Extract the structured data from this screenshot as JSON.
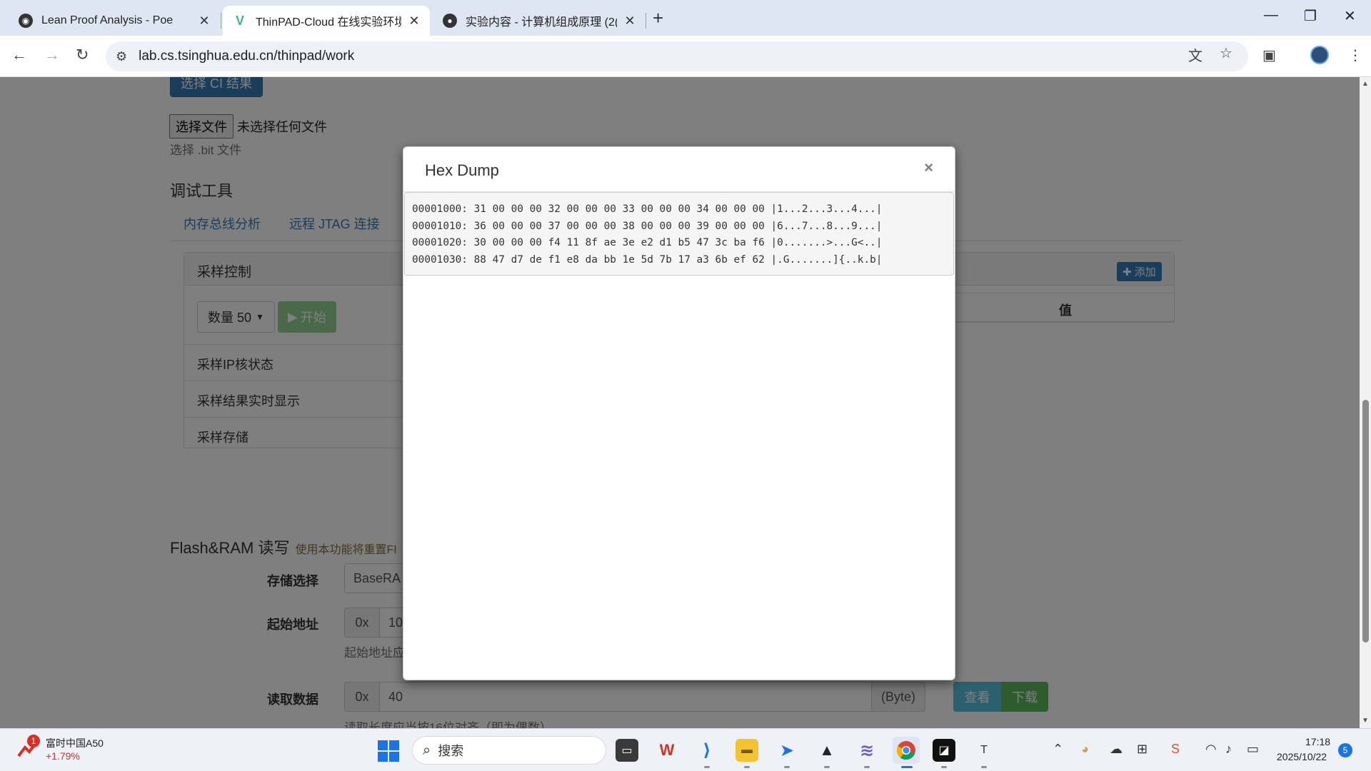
{
  "browser": {
    "tabs": [
      {
        "title": "Lean Proof Analysis - Poe",
        "favicon": "poe-icon"
      },
      {
        "title": "ThinPAD-Cloud 在线实验环境",
        "favicon": "vue-icon"
      },
      {
        "title": "实验内容 - 计算机组成原理 (2(",
        "favicon": "github-icon"
      }
    ],
    "url": "lab.cs.tsinghua.edu.cn/thinpad/work"
  },
  "page": {
    "ci_button": "选择 CI 结果",
    "file_button": "选择文件",
    "file_status": "未选择任何文件",
    "file_help": "选择 .bit 文件",
    "debug_title": "调试工具",
    "tabs": [
      "内存总线分析",
      "远程 JTAG 连接"
    ],
    "sampling": {
      "title": "采样控制",
      "count_label": "数量 50",
      "start_label": "开始",
      "items": [
        "采样IP核状态",
        "采样结果实时显示",
        "采样存储"
      ]
    },
    "add_label": "添加",
    "value_header": "值",
    "flash": {
      "title": "Flash&RAM 读写",
      "note": "使用本功能将重置FI",
      "storage_label": "存储选择",
      "storage_value": "BaseRA",
      "start_addr_label": "起始地址",
      "start_addr_prefix": "0x",
      "start_addr_value": "10",
      "start_addr_help": "起始地址应",
      "read_label": "读取数据",
      "read_prefix": "0x",
      "read_value": "40",
      "read_unit": "(Byte)",
      "view_button": "查看",
      "download_button": "下载",
      "read_help": "读取长度应当按16位对齐（即为偶数）"
    }
  },
  "modal": {
    "title": "Hex Dump",
    "close": "×",
    "lines": [
      "00001000: 31 00 00 00 32 00 00 00 33 00 00 00 34 00 00 00 |1...2...3...4...|",
      "00001010: 36 00 00 00 37 00 00 00 38 00 00 00 39 00 00 00 |6...7...8...9...|",
      "00001020: 30 00 00 00 f4 11 8f ae 3e e2 d1 b5 47 3c ba f6 |0.......>...G<..|",
      "00001030: 88 47 d7 de f1 e8 da bb 1e 5d 7b 17 a3 6b ef 62 |.G.......]{..k.b|"
    ]
  },
  "taskbar": {
    "stock_name": "富时中国A50",
    "stock_change": "+1.79%",
    "stock_badge": "1",
    "search_placeholder": "搜索",
    "time": "17:18",
    "date": "2025/10/22",
    "notifications": "5"
  },
  "colors": {
    "primary": "#337ab7",
    "success": "#5cb85c",
    "info": "#5bc0de",
    "stock_red": "#d93025"
  }
}
